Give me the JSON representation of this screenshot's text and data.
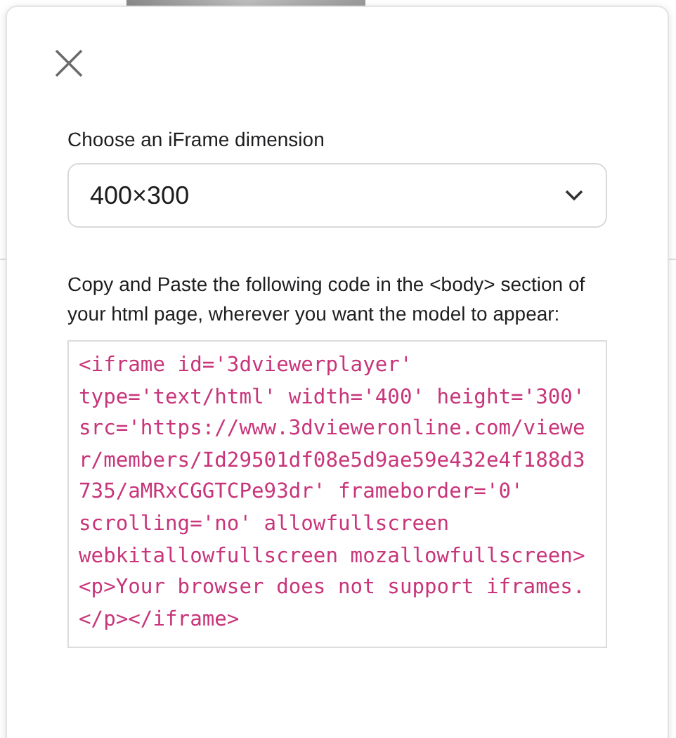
{
  "dialog": {
    "dimension_label": "Choose an iFrame dimension",
    "dimension_select": {
      "value": "400×300"
    },
    "instructions": "Copy and Paste the following code in the <body> section of your html page, wherever you want the model to appear:",
    "code_lines": [
      "<iframe id='3dviewerplayer'",
      "type='text/html' width='400' height='300'",
      "src='https://www.3dvieweronline.com/viewe",
      "r/members/Id29501df08e5d9ae59e432e4f188d3",
      "735/aMRxCGGTCPe93dr' frameborder='0'",
      "scrolling='no' allowfullscreen",
      "webkitallowfullscreen mozallowfullscreen>",
      "<p>Your browser does not support iframes.",
      "</p></iframe>"
    ]
  }
}
